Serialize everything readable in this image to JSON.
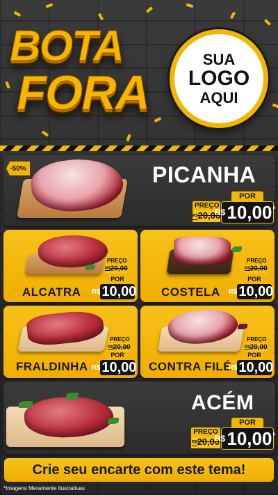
{
  "header": {
    "title_line1": "BOTA",
    "title_line2": "FORA",
    "logo_line1": "SUA",
    "logo_line2": "LOGO",
    "logo_line3": "AQUI"
  },
  "products": {
    "picanha": {
      "name": "PICANHA",
      "discount": "-50%",
      "preco_label": "PREÇO",
      "old_price": "20,00",
      "old_price_prefix": "R$",
      "por_label": "POR",
      "currency": "R$",
      "price": "10,00",
      "unit": "KG"
    },
    "alcatra": {
      "name": "ALCATRA",
      "preco_label": "PREÇO",
      "old_price": "20,00",
      "old_price_prefix": "R$",
      "por_label": "POR",
      "currency": "R$",
      "price": "10,00",
      "unit": "KG"
    },
    "costela": {
      "name": "COSTELA",
      "preco_label": "PREÇO",
      "old_price": "20,00",
      "old_price_prefix": "R$",
      "por_label": "POR",
      "currency": "R$",
      "price": "10,00",
      "unit": "KG"
    },
    "fraldinha": {
      "name": "FRALDINHA",
      "preco_label": "PREÇO",
      "old_price": "20,00",
      "old_price_prefix": "R$",
      "por_label": "POR",
      "currency": "R$",
      "price": "10,00",
      "unit": "KG"
    },
    "contra_file": {
      "name": "CONTRA FILÉ",
      "preco_label": "PREÇO",
      "old_price": "20,00",
      "old_price_prefix": "R$",
      "por_label": "POR",
      "currency": "R$",
      "price": "10,00",
      "unit": "KG"
    },
    "acem": {
      "name": "ACÉM",
      "preco_label": "PREÇO",
      "old_price": "20,00",
      "old_price_prefix": "R$",
      "por_label": "POR",
      "currency": "R$",
      "price": "10,00",
      "unit": "KG"
    }
  },
  "cta": {
    "text": "Crie seu encarte com este tema!"
  },
  "footnote": "*Imagens Meramente Ilustrativas",
  "colors": {
    "accent": "#f2b705",
    "dark": "#2c2c2c",
    "text_dark": "#1a1a1a"
  }
}
